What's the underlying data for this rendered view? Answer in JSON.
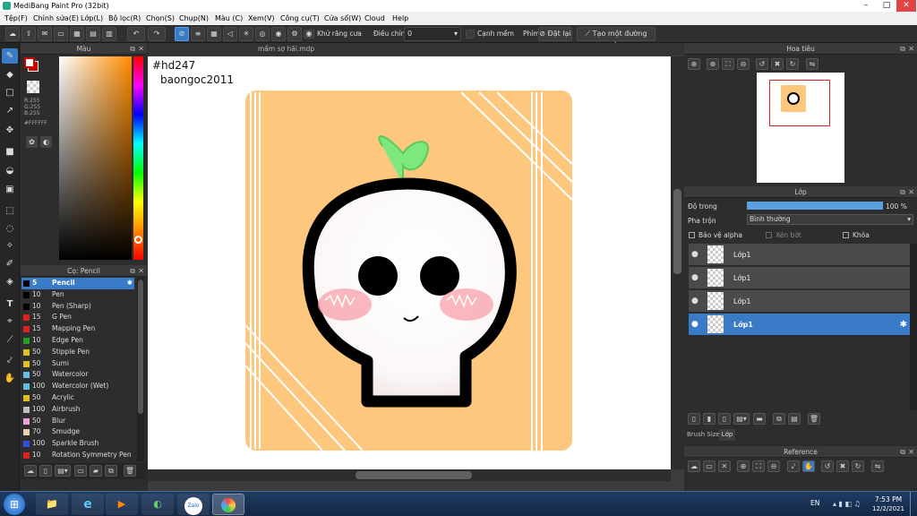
{
  "window": {
    "title": "MediBang Paint Pro (32bit)",
    "minimize": "–",
    "maximize": "□",
    "close": "✕"
  },
  "menu": [
    "Tệp(F)",
    "Chỉnh sửa(E)",
    "Lớp(L)",
    "Bộ lọc(R)",
    "Chọn(S)",
    "Chụp(N)",
    "Màu (C)",
    "Xem(V)",
    "Công cụ(T)",
    "Cửa sổ(W)",
    "Cloud",
    "Help"
  ],
  "toolbar": {
    "antialias_label": "Khử răng cưa",
    "correction_label": "Điều chỉnh",
    "correction_value": "0",
    "sharp_label": "Cạnh mềm",
    "key_label": "Phím",
    "reset_label": "Đặt lại",
    "straight_label": "Tạo một đường thẳng"
  },
  "color_panel": {
    "title": "Màu",
    "r": "R:255",
    "g": "G:255",
    "b": "B:255",
    "hex": "#FFFFFF",
    "fg_color": "#ffffff",
    "bg_color": "#cc0000"
  },
  "brush_panel": {
    "title": "Cọ: Pencil",
    "items": [
      {
        "size": "5",
        "name": "Pencil",
        "color": "#000000"
      },
      {
        "size": "10",
        "name": "Pen",
        "color": "#000000"
      },
      {
        "size": "10",
        "name": "Pen (Sharp)",
        "color": "#000000"
      },
      {
        "size": "15",
        "name": "G Pen",
        "color": "#e02020"
      },
      {
        "size": "15",
        "name": "Mapping Pen",
        "color": "#e02020"
      },
      {
        "size": "10",
        "name": "Edge Pen",
        "color": "#20a020"
      },
      {
        "size": "50",
        "name": "Stipple Pen",
        "color": "#e0c020"
      },
      {
        "size": "50",
        "name": "Sumi",
        "color": "#e0c020"
      },
      {
        "size": "50",
        "name": "Watercolor",
        "color": "#60c0e0"
      },
      {
        "size": "100",
        "name": "Watercolor (Wet)",
        "color": "#60c0e0"
      },
      {
        "size": "50",
        "name": "Acrylic",
        "color": "#e0c020"
      },
      {
        "size": "100",
        "name": "Airbrush",
        "color": "#c0c0c0"
      },
      {
        "size": "50",
        "name": "Blur",
        "color": "#f0a0e0"
      },
      {
        "size": "70",
        "name": "Smudge",
        "color": "#f0d0b0"
      },
      {
        "size": "100",
        "name": "Sparkle Brush",
        "color": "#3050e0"
      },
      {
        "size": "10",
        "name": "Rotation Symmetry Pen",
        "color": "#e02020"
      }
    ]
  },
  "document": {
    "tab": "mầm sợ hãi.mdp",
    "hashtag": "#hd247",
    "author": "baongoc2011"
  },
  "navigator": {
    "title": "Hoa tiêu"
  },
  "layer_panel": {
    "title": "Lớp",
    "opacity_label": "Độ trong",
    "opacity_value": "100 %",
    "opacity": 1.0,
    "blend_label": "Pha trộn",
    "blend_value": "Bình thường",
    "protect_alpha": "Bảo vệ alpha",
    "clipping": "Xén bớt",
    "lock": "Khóa",
    "layers": [
      "Lớp1",
      "Lớp1",
      "Lớp1",
      "Lớp1"
    ],
    "selected_index": 3,
    "tab_brush": "Brush Size",
    "tab_layer": "Lớp"
  },
  "reference": {
    "title": "Reference"
  },
  "taskbar": {
    "lang": "EN",
    "time": "7:53 PM",
    "date": "12/2/2021",
    "zalo": "Zalo"
  }
}
